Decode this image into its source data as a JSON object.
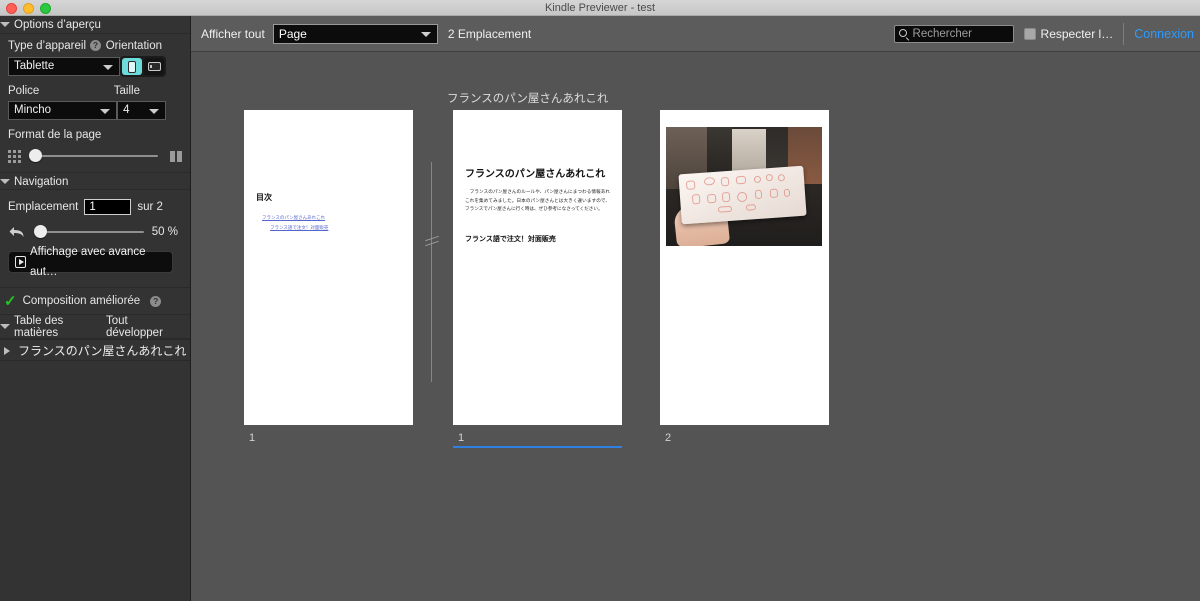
{
  "window": {
    "title": "Kindle Previewer - test",
    "traffic_lights": [
      "close-button",
      "minimize-button",
      "maximize-button"
    ]
  },
  "sidebar": {
    "preview_options": {
      "header": "Options d’aperçu",
      "device_type_label": "Type d’appareil",
      "device_type_value": "Tablette",
      "orientation_label": "Orientation",
      "orientation_portrait": "portrait",
      "orientation_landscape": "landscape",
      "font_label": "Police",
      "font_value": "Mincho",
      "size_label": "Taille",
      "size_value": "4",
      "page_format_label": "Format de la page",
      "page_format_min_icon": "grid-icon",
      "page_format_max_icon": "columns-icon"
    },
    "navigation": {
      "header": "Navigation",
      "location_label": "Emplacement",
      "location_value": "1",
      "location_of": "sur 2",
      "reset_icon": "undo-arrow-icon",
      "zoom_value": "50 %",
      "auto_advance_button": "Affichage avec avance aut…"
    },
    "enhanced_typesetting": {
      "label": "Composition améliorée",
      "checked": true
    },
    "toc": {
      "header": "Table des matières",
      "expand_all": "Tout développer",
      "items": [
        {
          "label": "フランスのパン屋さんあれこれ"
        }
      ]
    }
  },
  "toolbar": {
    "show_all_label": "Afficher tout",
    "view_mode_value": "Page",
    "location_count": "2 Emplacement",
    "search_placeholder": "Rechercher",
    "match_case_label": "Respecter l…",
    "signin_link": "Connexion"
  },
  "workspace": {
    "spread_title": "フランスのパン屋さんあれこれ",
    "pages": [
      {
        "number": "1",
        "selected": false,
        "heading": "目次",
        "links": [
          "フランスのパン屋さんあれこれ",
          "フランス語で注文！対面販売"
        ]
      },
      {
        "number": "1",
        "selected": true,
        "heading": "フランスのパン屋さんあれこれ",
        "body": "　フランスのパン屋さんのルールや、パン屋さんにまつわる情報あれこれを集めてみました。日本のパン屋さんとは大きく違いますので、フランスでパン屋さんに行く時は、ぜひ参考になさってください。",
        "subheading": "フランス語で注文！対面販売"
      },
      {
        "number": "2",
        "selected": false,
        "photo_alt": "hand-holding-wrapped-baguette"
      }
    ]
  },
  "colors": {
    "accent_blue": "#2f80e0",
    "link_blue": "#2b9bff",
    "toggle_active": "#6fdcdc",
    "check_green": "#22c722",
    "workspace_bg": "#545454",
    "sidebar_bg": "#333333",
    "toolbar_bg": "#5c5c5c"
  }
}
